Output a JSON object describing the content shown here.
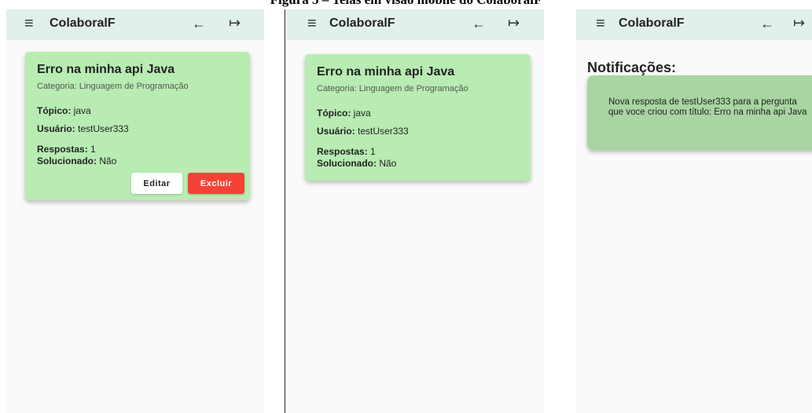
{
  "figure_caption": "Figura 5 – Telas em visão mobile do ColaboralF",
  "app": {
    "title": "ColaboralF"
  },
  "icons": {
    "menu": "menu-icon",
    "back": "arrow-left-icon",
    "logout": "logout-icon"
  },
  "colors": {
    "appbar": "#e1f0e8",
    "card": "#b8ecb2",
    "notification": "#a8d5a1",
    "delete": "#f44336"
  },
  "question": {
    "title": "Erro na minha api Java",
    "category": "Categoria: Linguagem de Programação",
    "topic_label": "Tópico:",
    "topic": "java",
    "user_label": "Usuário:",
    "user": "testUser333",
    "answers_label": "Respostas:",
    "answers": "1",
    "solved_label": "Solucionado:",
    "solved": "Não"
  },
  "buttons": {
    "edit": "Editar",
    "delete": "Excluir"
  },
  "notifications": {
    "heading": "Notificações:",
    "items": [
      "Nova resposta de testUser333 para a pergunta que voce criou com título: Erro na minha api Java"
    ]
  }
}
